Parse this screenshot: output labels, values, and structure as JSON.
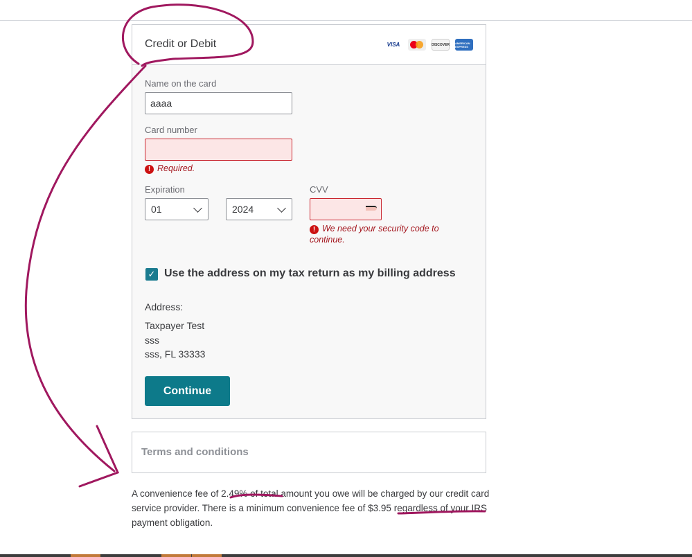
{
  "card": {
    "title": "Credit or Debit",
    "logos": [
      "visa",
      "mastercard",
      "discover",
      "american-express"
    ],
    "name_label": "Name on the card",
    "name_value": "aaaa",
    "number_label": "Card number",
    "number_value": "",
    "number_error": "Required.",
    "expiration_label": "Expiration",
    "exp_month": "01",
    "exp_year": "2024",
    "cvv_label": "CVV",
    "cvv_value": "",
    "cvv_error": "We need your security code to continue.",
    "billing_checkbox_label": "Use the address on my tax return as my billing address",
    "billing_checked": true,
    "address_label": "Address:",
    "address_lines": [
      "Taxpayer Test",
      "sss",
      "sss, FL 33333"
    ],
    "continue_label": "Continue"
  },
  "terms": {
    "label": "Terms and conditions"
  },
  "fee_text": "A convenience fee of 2.49% of total amount you owe will be charged by our credit card service provider. There is a minimum convenience fee of $3.95 regardless of your IRS payment obligation.",
  "colors": {
    "accent": "#0d7a8a",
    "error": "#a3141c",
    "annotation": "#a0185f"
  }
}
